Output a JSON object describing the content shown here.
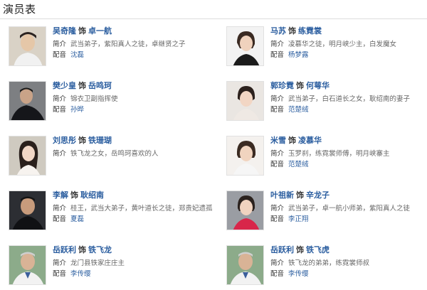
{
  "page": {
    "title": "演员表"
  },
  "labels": {
    "played_as": "饰",
    "intro": "简介",
    "voice": "配音"
  },
  "colors": {
    "link": "#2a5d9f",
    "divider": "#dcdcdc"
  },
  "cast": [
    {
      "actor": "吴奇隆",
      "role": "卓一航",
      "intro": "武当弟子，紫阳真人之徒，卓继贤之子",
      "voice": "沈磊"
    },
    {
      "actor": "马苏",
      "role": "练霓裳",
      "intro": "凌慕华之徒，明月峡少主，白发魔女",
      "voice": "杨梦露"
    },
    {
      "actor": "樊少皇",
      "role": "岳鸣珂",
      "intro": "锦衣卫副指挥使",
      "voice": "孙晔"
    },
    {
      "actor": "郭珍霓",
      "role": "何萼华",
      "intro": "武当弟子，白石道长之女，耿绍南的妻子",
      "voice": "范楚绒"
    },
    {
      "actor": "刘思彤",
      "role": "铁珊瑚",
      "intro": "铁飞龙之女，岳鸣珂喜欢的人",
      "voice": ""
    },
    {
      "actor": "米雪",
      "role": "凌慕华",
      "intro": "玉罗刹，练霓裳师傅，明月峡寨主",
      "voice": "范楚绒"
    },
    {
      "actor": "李解",
      "role": "耿绍南",
      "intro": "桂王，武当大弟子，黄叶道长之徒，郑贵妃遗孤",
      "voice": "夏磊"
    },
    {
      "actor": "叶祖新",
      "role": "辛龙子",
      "intro": "武当弟子，卓一航小师弟，紫阳真人之徒",
      "voice": "李正翔"
    },
    {
      "actor": "岳跃利",
      "role": "铁飞龙",
      "intro": "龙门县铁家庄庄主",
      "voice": "李传缨"
    },
    {
      "actor": "岳跃利",
      "role": "铁飞虎",
      "intro": "铁飞龙的弟弟，练霓裳师叔",
      "voice": "李传缨"
    }
  ]
}
